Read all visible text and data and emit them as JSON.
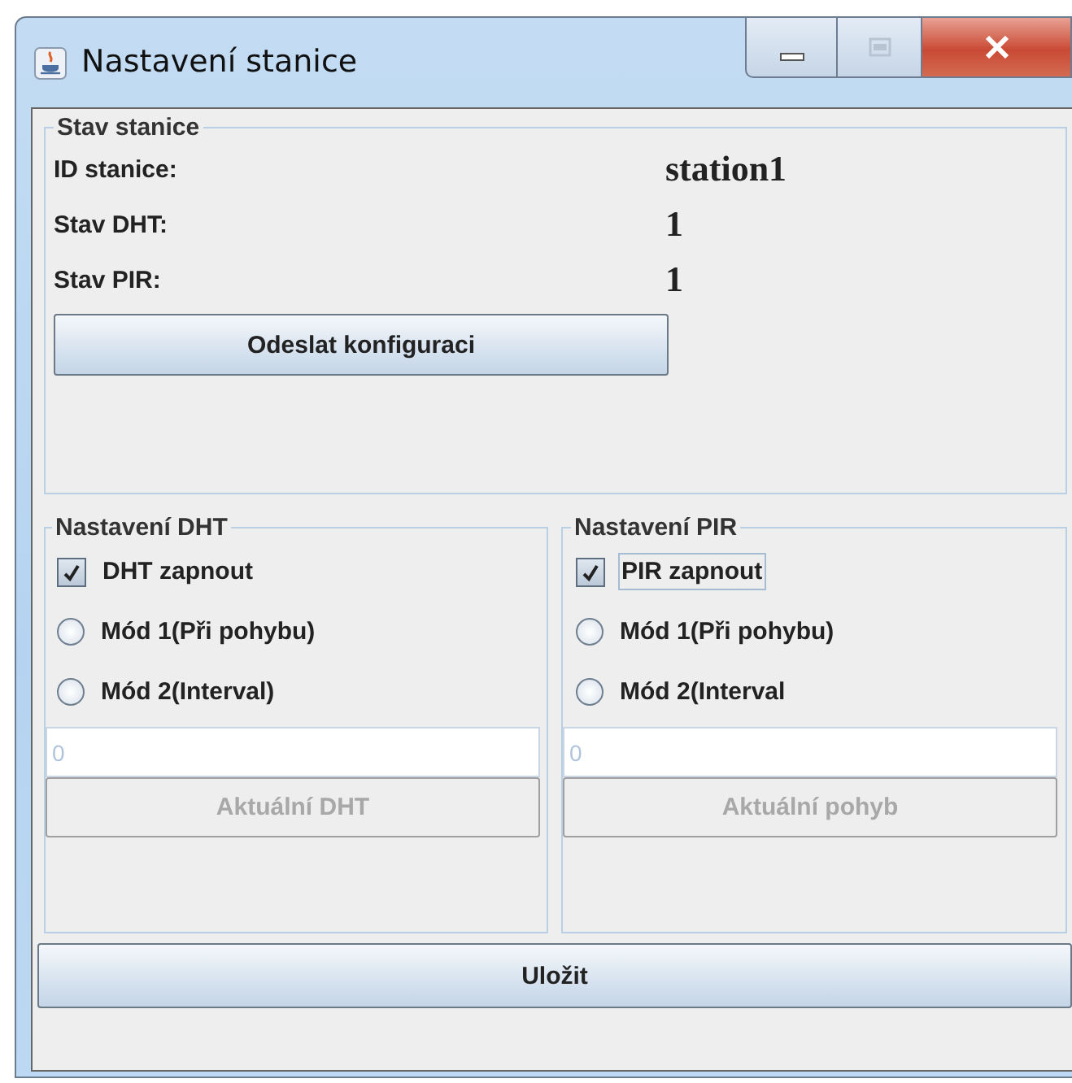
{
  "window": {
    "title": "Nastavení stanice"
  },
  "status": {
    "title": "Stav stanice",
    "rows": [
      {
        "label": "ID stanice:",
        "value": "station1"
      },
      {
        "label": "Stav DHT:",
        "value": "1"
      },
      {
        "label": "Stav PIR:",
        "value": "1"
      }
    ],
    "button": {
      "label": "Odeslat konfiguraci",
      "disabled": false
    }
  },
  "groups": [
    {
      "title": "Nastavení DHT",
      "checkbox": {
        "label": "DHT zapnout",
        "checked": true,
        "focused": false
      },
      "radios": [
        {
          "label": "Mód 1(Při pohybu)",
          "selected": false
        },
        {
          "label": "Mód 2(Interval)",
          "selected": false
        }
      ],
      "field": {
        "value": "0",
        "disabled": true
      },
      "button": {
        "label": "Aktuální DHT",
        "disabled": true
      }
    },
    {
      "title": "Nastavení PIR",
      "checkbox": {
        "label": "PIR zapnout",
        "checked": true,
        "focused": true
      },
      "radios": [
        {
          "label": "Mód 1(Při pohybu)",
          "selected": false
        },
        {
          "label": "Mód 2(Interval",
          "selected": false
        }
      ],
      "field": {
        "value": "0",
        "disabled": true
      },
      "button": {
        "label": "Aktuální pohyb",
        "disabled": true
      }
    }
  ],
  "save_button": {
    "label": "Uložit",
    "disabled": false
  }
}
